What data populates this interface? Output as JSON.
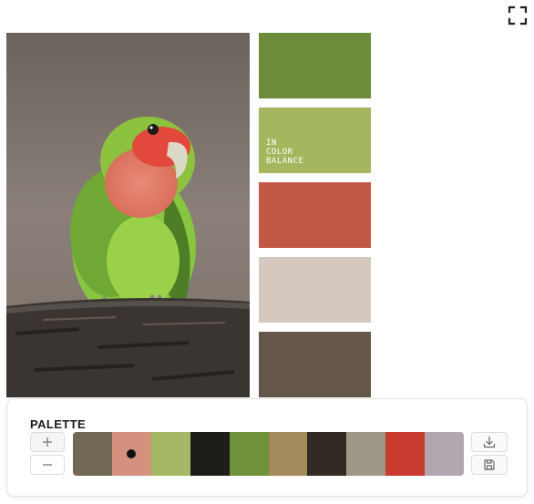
{
  "toolbar": {
    "fullscreen_icon": "fullscreen-icon"
  },
  "swatches": [
    {
      "color": "#6c8c39",
      "label": ""
    },
    {
      "color": "#a4b65e",
      "label": "IN\nCOLOR\nBALANCE"
    },
    {
      "color": "#c25745",
      "label": ""
    },
    {
      "color": "#d5c9bf",
      "label": ""
    },
    {
      "color": "#65584a",
      "label": ""
    }
  ],
  "palette": {
    "title": "PALETTE",
    "add_icon": "plus-icon",
    "remove_icon": "minus-icon",
    "download_icon": "download-icon",
    "save_icon": "save-icon",
    "colors": [
      "#726755",
      "#d3917e",
      "#a5b865",
      "#1e1e18",
      "#6e9139",
      "#a28a5b",
      "#332a24",
      "#a09886",
      "#c93a2f",
      "#b2a6b1"
    ],
    "selected_index": 1
  }
}
